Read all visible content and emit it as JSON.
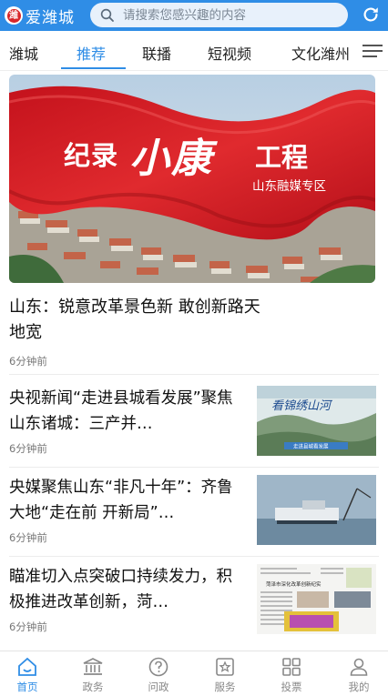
{
  "header": {
    "app_name": "爱潍城",
    "logo_glyph": "潍",
    "search_placeholder": "请搜索您感兴趣的内容",
    "accent_color": "#2f8de6"
  },
  "tabs": [
    {
      "label": "潍城",
      "active": false
    },
    {
      "label": "推荐",
      "active": true
    },
    {
      "label": "联播",
      "active": false
    },
    {
      "label": "短视频",
      "active": false
    },
    {
      "label": "文化潍州",
      "active": false
    }
  ],
  "hero": {
    "title_part1": "纪录",
    "title_part2": "小康",
    "title_part3": "工程",
    "subtitle": "山东融媒专区"
  },
  "lead": {
    "title": "山东：锐意改革景色新 敢创新路天地宽",
    "time": "6分钟前"
  },
  "articles": [
    {
      "title": "央视新闻“走进县城看发展”聚焦山东诸城：三产并…",
      "time": "6分钟前",
      "thumb_caption": "看锦绣山河",
      "thumb_banner": "走进县城看发展"
    },
    {
      "title": "央媒聚焦山东“非凡十年”：齐鲁大地“走在前 开新局”…",
      "time": "6分钟前"
    },
    {
      "title": "瞄准切入点突破口持续发力，积极推进改革创新，菏…",
      "time": "6分钟前",
      "thumb_headline": "菏泽市深化改革创新纪实"
    }
  ],
  "bottom_nav": [
    {
      "label": "首页",
      "icon": "home-icon",
      "active": true
    },
    {
      "label": "政务",
      "icon": "government-building-icon",
      "active": false
    },
    {
      "label": "问政",
      "icon": "question-icon",
      "active": false
    },
    {
      "label": "服务",
      "icon": "service-star-icon",
      "active": false
    },
    {
      "label": "投票",
      "icon": "vote-grid-icon",
      "active": false
    },
    {
      "label": "我的",
      "icon": "user-icon",
      "active": false
    }
  ]
}
